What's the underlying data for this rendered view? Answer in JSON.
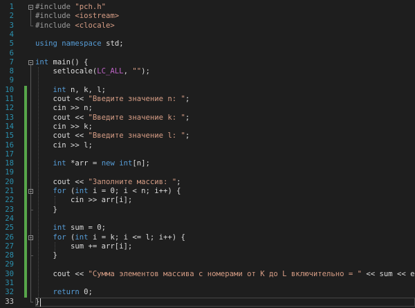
{
  "editor": {
    "colors": {
      "background": "#1e1e1e",
      "line_number": "#2b91af",
      "keyword": "#569cd6",
      "string": "#d69d85",
      "preprocessor": "#9b9b9b",
      "macro": "#bd63c5",
      "text": "#dcdcdc",
      "change_bar": "#57a64a"
    },
    "current_line": 33,
    "lines": [
      {
        "n": "1",
        "tokens": [
          {
            "t": "#include ",
            "c": "pre"
          },
          {
            "t": "\"pch.h\"",
            "c": "str"
          }
        ]
      },
      {
        "n": "2",
        "tokens": [
          {
            "t": "#include ",
            "c": "pre"
          },
          {
            "t": "<iostream>",
            "c": "str"
          }
        ]
      },
      {
        "n": "3",
        "tokens": [
          {
            "t": "#include ",
            "c": "pre"
          },
          {
            "t": "<clocale>",
            "c": "str"
          }
        ]
      },
      {
        "n": "4",
        "tokens": []
      },
      {
        "n": "5",
        "tokens": [
          {
            "t": "using ",
            "c": "kw"
          },
          {
            "t": "namespace ",
            "c": "kw"
          },
          {
            "t": "std;",
            "c": "plain"
          }
        ]
      },
      {
        "n": "6",
        "tokens": []
      },
      {
        "n": "7",
        "tokens": [
          {
            "t": "int ",
            "c": "kw"
          },
          {
            "t": "main() {",
            "c": "plain"
          }
        ]
      },
      {
        "n": "8",
        "tokens": [
          {
            "t": "    setlocale(",
            "c": "plain"
          },
          {
            "t": "LC_ALL",
            "c": "macro"
          },
          {
            "t": ", ",
            "c": "plain"
          },
          {
            "t": "\"\"",
            "c": "str"
          },
          {
            "t": ");",
            "c": "plain"
          }
        ]
      },
      {
        "n": "9",
        "tokens": []
      },
      {
        "n": "10",
        "tokens": [
          {
            "t": "    ",
            "c": "plain"
          },
          {
            "t": "int ",
            "c": "kw"
          },
          {
            "t": "n, k, l;",
            "c": "plain"
          }
        ]
      },
      {
        "n": "11",
        "tokens": [
          {
            "t": "    cout << ",
            "c": "plain"
          },
          {
            "t": "\"Введите значение n: \"",
            "c": "str"
          },
          {
            "t": ";",
            "c": "plain"
          }
        ]
      },
      {
        "n": "12",
        "tokens": [
          {
            "t": "    cin >> n;",
            "c": "plain"
          }
        ]
      },
      {
        "n": "13",
        "tokens": [
          {
            "t": "    cout << ",
            "c": "plain"
          },
          {
            "t": "\"Введите значение k: \"",
            "c": "str"
          },
          {
            "t": ";",
            "c": "plain"
          }
        ]
      },
      {
        "n": "14",
        "tokens": [
          {
            "t": "    cin >> k;",
            "c": "plain"
          }
        ]
      },
      {
        "n": "15",
        "tokens": [
          {
            "t": "    cout << ",
            "c": "plain"
          },
          {
            "t": "\"Введите значение l: \"",
            "c": "str"
          },
          {
            "t": ";",
            "c": "plain"
          }
        ]
      },
      {
        "n": "16",
        "tokens": [
          {
            "t": "    cin >> l;",
            "c": "plain"
          }
        ]
      },
      {
        "n": "17",
        "tokens": []
      },
      {
        "n": "18",
        "tokens": [
          {
            "t": "    ",
            "c": "plain"
          },
          {
            "t": "int ",
            "c": "kw"
          },
          {
            "t": "*arr = ",
            "c": "plain"
          },
          {
            "t": "new ",
            "c": "kw"
          },
          {
            "t": "int",
            "c": "kw"
          },
          {
            "t": "[n];",
            "c": "plain"
          }
        ]
      },
      {
        "n": "19",
        "tokens": []
      },
      {
        "n": "20",
        "tokens": [
          {
            "t": "    cout << ",
            "c": "plain"
          },
          {
            "t": "\"Заполните массив: \"",
            "c": "str"
          },
          {
            "t": ";",
            "c": "plain"
          }
        ]
      },
      {
        "n": "21",
        "tokens": [
          {
            "t": "    ",
            "c": "plain"
          },
          {
            "t": "for ",
            "c": "kw"
          },
          {
            "t": "(",
            "c": "plain"
          },
          {
            "t": "int ",
            "c": "kw"
          },
          {
            "t": "i = 0; i < n; i++) {",
            "c": "plain"
          }
        ]
      },
      {
        "n": "22",
        "tokens": [
          {
            "t": "        cin >> arr[i];",
            "c": "plain"
          }
        ]
      },
      {
        "n": "23",
        "tokens": [
          {
            "t": "    }",
            "c": "plain"
          }
        ]
      },
      {
        "n": "24",
        "tokens": []
      },
      {
        "n": "25",
        "tokens": [
          {
            "t": "    ",
            "c": "plain"
          },
          {
            "t": "int ",
            "c": "kw"
          },
          {
            "t": "sum = 0;",
            "c": "plain"
          }
        ]
      },
      {
        "n": "26",
        "tokens": [
          {
            "t": "    ",
            "c": "plain"
          },
          {
            "t": "for ",
            "c": "kw"
          },
          {
            "t": "(",
            "c": "plain"
          },
          {
            "t": "int ",
            "c": "kw"
          },
          {
            "t": "i = k; i <= l; i++) {",
            "c": "plain"
          }
        ]
      },
      {
        "n": "27",
        "tokens": [
          {
            "t": "        sum += arr[i];",
            "c": "plain"
          }
        ]
      },
      {
        "n": "28",
        "tokens": [
          {
            "t": "    }",
            "c": "plain"
          }
        ]
      },
      {
        "n": "29",
        "tokens": []
      },
      {
        "n": "30",
        "tokens": [
          {
            "t": "    cout << ",
            "c": "plain"
          },
          {
            "t": "\"Сумма элементов массива с номерами от K до L включительно = \"",
            "c": "str"
          },
          {
            "t": " << sum << endl;",
            "c": "plain"
          }
        ]
      },
      {
        "n": "31",
        "tokens": []
      },
      {
        "n": "32",
        "tokens": [
          {
            "t": "    ",
            "c": "plain"
          },
          {
            "t": "return ",
            "c": "kw"
          },
          {
            "t": "0;",
            "c": "plain"
          }
        ]
      },
      {
        "n": "33",
        "tokens": [
          {
            "t": "}",
            "c": "plain"
          }
        ]
      }
    ]
  }
}
